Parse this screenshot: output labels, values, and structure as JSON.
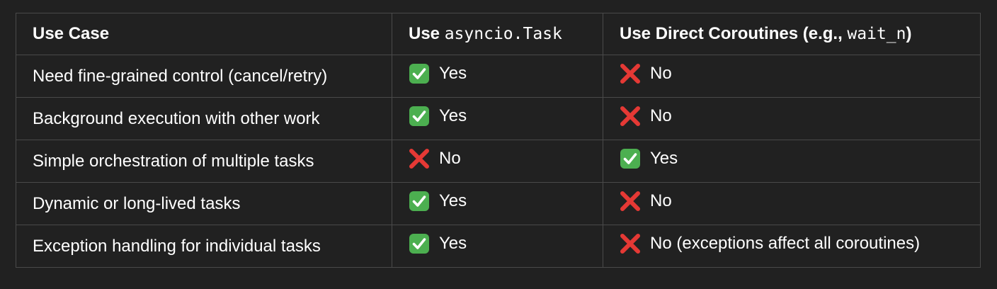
{
  "colors": {
    "background": "#212121",
    "border": "#4a4a4a",
    "check_box": "#4caf50",
    "cross": "#e53935"
  },
  "table": {
    "headers": {
      "col1": "Use Case",
      "col2_prefix": "Use ",
      "col2_code": "asyncio.Task",
      "col3_prefix": "Use Direct Coroutines (e.g., ",
      "col3_code": "wait_n",
      "col3_suffix": ")"
    },
    "rows": [
      {
        "use_case": "Need fine-grained control (cancel/retry)",
        "task": {
          "icon": "check-mark-icon",
          "text": "Yes"
        },
        "direct": {
          "icon": "cross-mark-icon",
          "text": "No"
        }
      },
      {
        "use_case": "Background execution with other work",
        "task": {
          "icon": "check-mark-icon",
          "text": "Yes"
        },
        "direct": {
          "icon": "cross-mark-icon",
          "text": "No"
        }
      },
      {
        "use_case": "Simple orchestration of multiple tasks",
        "task": {
          "icon": "cross-mark-icon",
          "text": "No"
        },
        "direct": {
          "icon": "check-mark-icon",
          "text": "Yes"
        }
      },
      {
        "use_case": "Dynamic or long-lived tasks",
        "task": {
          "icon": "check-mark-icon",
          "text": "Yes"
        },
        "direct": {
          "icon": "cross-mark-icon",
          "text": "No"
        }
      },
      {
        "use_case": "Exception handling for individual tasks",
        "task": {
          "icon": "check-mark-icon",
          "text": "Yes"
        },
        "direct": {
          "icon": "cross-mark-icon",
          "text": "No (exceptions affect all coroutines)"
        }
      }
    ]
  }
}
